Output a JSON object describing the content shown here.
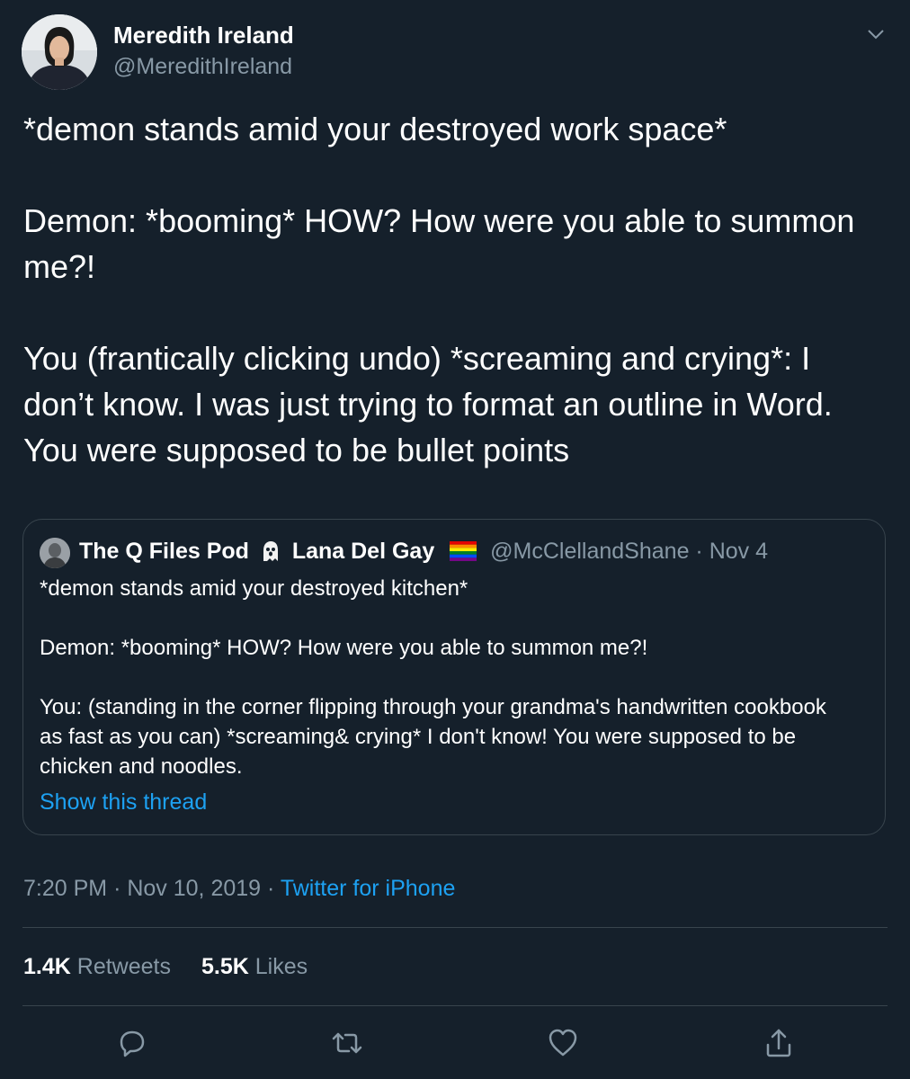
{
  "tweet": {
    "author_name": "Meredith Ireland",
    "author_handle": "@MeredithIreland",
    "text": "*demon stands amid your destroyed work space*\n\nDemon: *booming* HOW? How were you able to summon me?!\n\nYou (frantically clicking undo) *screaming and crying*: I don’t know. I was just trying to format an outline in Word. You were supposed to be bullet points",
    "time": "7:20 PM",
    "date": "Nov 10, 2019",
    "source": "Twitter for iPhone",
    "retweets_count": "1.4K",
    "retweets_label": "Retweets",
    "likes_count": "5.5K",
    "likes_label": "Likes"
  },
  "quoted": {
    "name_part1": "The Q Files Pod",
    "name_part2": "Lana Del Gay",
    "handle": "@McClellandShane",
    "date": "Nov 4",
    "text": "*demon stands amid your destroyed kitchen*\n\nDemon: *booming* HOW? How were you able to summon me?!\n\nYou: (standing in the corner flipping through your grandma's handwritten cookbook as fast as you can) *screaming& crying* I don't know! You were supposed to be chicken and noodles.",
    "show_thread": "Show this thread"
  },
  "icons": {
    "menu": "chevron-down-icon",
    "reply": "reply-icon",
    "retweet": "retweet-icon",
    "like": "heart-icon",
    "share": "share-icon",
    "ghost": "ghost-emoji",
    "flag": "rainbow-flag-emoji"
  },
  "colors": {
    "background": "#15202b",
    "secondary_text": "#8899a6",
    "link": "#1da1f2",
    "border": "#38444d"
  }
}
